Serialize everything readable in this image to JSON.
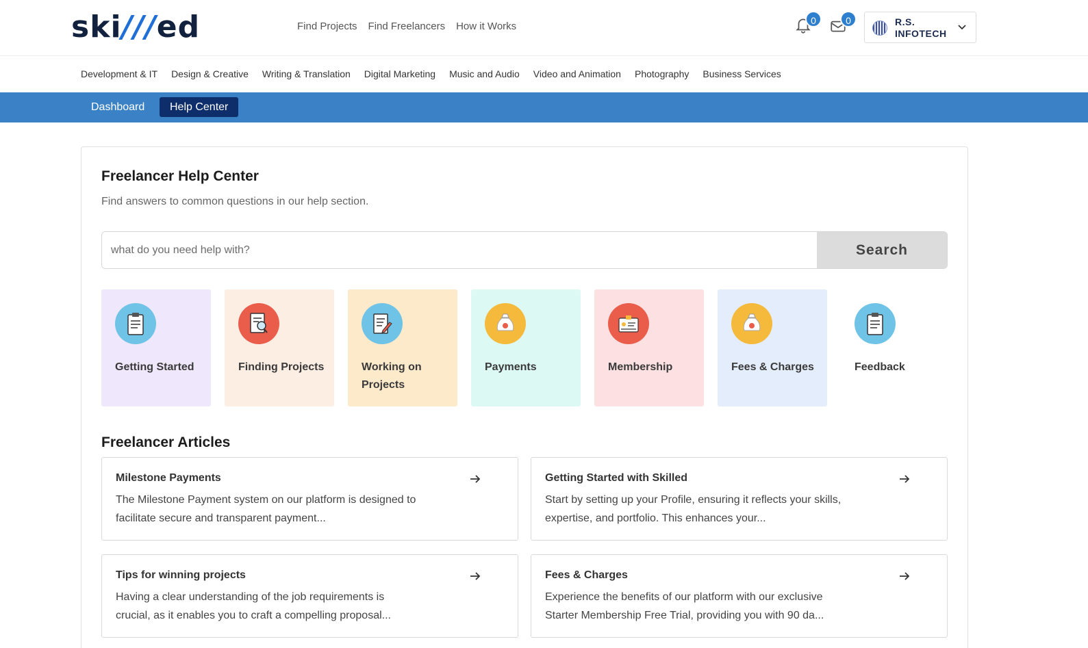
{
  "header": {
    "logo": {
      "prefix": "ski",
      "highlight": "///",
      "suffix": "ed"
    },
    "nav": [
      "Find Projects",
      "Find Freelancers",
      "How it Works"
    ],
    "notifications_count": "0",
    "messages_count": "0",
    "account": {
      "line1": "R.S.",
      "line2": "INFOTECH"
    }
  },
  "categories": [
    "Development & IT",
    "Design & Creative",
    "Writing & Translation",
    "Digital Marketing",
    "Music and Audio",
    "Video and Animation",
    "Photography",
    "Business Services"
  ],
  "subnav": {
    "dashboard": "Dashboard",
    "help_center": "Help Center"
  },
  "help": {
    "title": "Freelancer Help Center",
    "subtitle": "Find answers to common questions in our help section.",
    "search_placeholder": "what do you need help with?",
    "search_button": "Search"
  },
  "tiles": [
    {
      "label": "Getting Started",
      "bg": "#efe7fb",
      "icon": "clipboard-icon",
      "icon_bg": "#6fc3e6"
    },
    {
      "label": "Finding Projects",
      "bg": "#fdeee4",
      "icon": "document-search-icon",
      "icon_bg": "#ea5d4a"
    },
    {
      "label": "Working on Projects",
      "bg": "#fdeacb",
      "icon": "document-edit-icon",
      "icon_bg": "#6fc3e6"
    },
    {
      "label": "Payments",
      "bg": "#ddf9f4",
      "icon": "money-bag-icon",
      "icon_bg": "#f5b93c"
    },
    {
      "label": "Membership",
      "bg": "#fde0e2",
      "icon": "id-card-icon",
      "icon_bg": "#ea5d4a"
    },
    {
      "label": "Fees & Charges",
      "bg": "#e4edfb",
      "icon": "money-bag-icon",
      "icon_bg": "#f5b93c"
    },
    {
      "label": "Feedback",
      "bg": "#ffffff",
      "icon": "clipboard-icon",
      "icon_bg": "#6fc3e6"
    }
  ],
  "articles_title": "Freelancer Articles",
  "articles": [
    {
      "title": "Milestone Payments",
      "desc": "The Milestone Payment system on our platform is designed to facilitate secure and transparent payment..."
    },
    {
      "title": "Getting Started with Skilled",
      "desc": "Start by setting up your Profile, ensuring it reflects your skills, expertise, and portfolio. This enhances your..."
    },
    {
      "title": "Tips for winning projects",
      "desc": "Having a clear understanding of the job requirements is crucial, as it enables you to craft a compelling proposal..."
    },
    {
      "title": "Fees & Charges",
      "desc": "Experience the benefits of our platform with our exclusive Starter Membership Free Trial, providing you with 90 da..."
    }
  ]
}
